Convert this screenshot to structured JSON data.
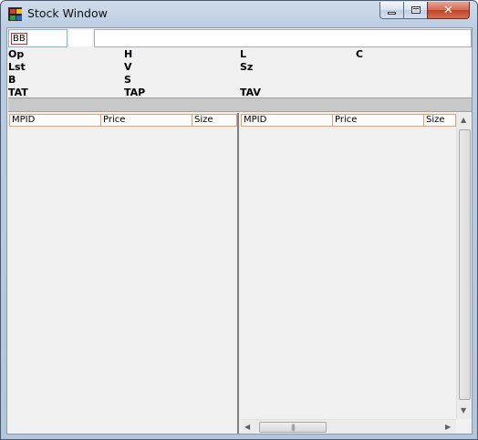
{
  "window": {
    "title": "Stock Window",
    "icon": "app-grid-icon",
    "controls": {
      "minimize": "minimize-icon",
      "maximize": "maximize-icon",
      "close": "close-icon"
    }
  },
  "symbol": {
    "value": "BB"
  },
  "description": {
    "value": ""
  },
  "quote_labels": {
    "open": "Op",
    "high": "H",
    "low": "L",
    "close": "C",
    "last": "Lst",
    "volume": "V",
    "size": "Sz",
    "bid": "B",
    "sell": "S",
    "tat": "TAT",
    "tap": "TAP",
    "tav": "TAV"
  },
  "book_left": {
    "columns": [
      "MPID",
      "Price",
      "Size"
    ]
  },
  "book_right": {
    "columns": [
      "MPID",
      "Price",
      "Size"
    ]
  },
  "colors": {
    "header_border": "#e8a06a",
    "symbol_border": "#c03030",
    "divider_bar": "#c8c8c8"
  }
}
